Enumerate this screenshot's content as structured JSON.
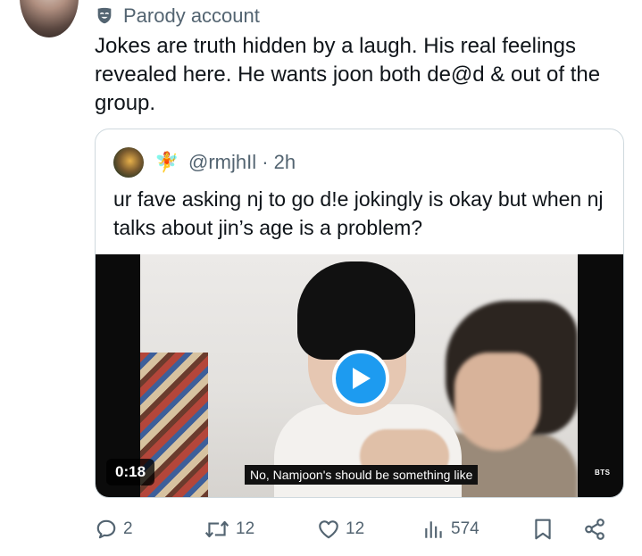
{
  "post": {
    "parody_label": "Parody account",
    "text": "Jokes are truth hidden by a laugh. His real feelings revealed here. He wants joon both de@d & out of the group."
  },
  "quote": {
    "emoji": "🧚",
    "handle": "@rmjhIl · 2h",
    "text": "ur fave asking nj to go d!e jokingly is okay but when nj talks about jin’s age is a problem?",
    "video": {
      "duration": "0:18",
      "subtitle": "No, Namjoon's should be something like",
      "channel_logo": "BTS"
    }
  },
  "actions": {
    "replies": "2",
    "reposts": "12",
    "likes": "12",
    "views": "574"
  },
  "colors": {
    "accent": "#1d9bf0",
    "secondary_text": "#536471",
    "border": "#cfd9de"
  }
}
